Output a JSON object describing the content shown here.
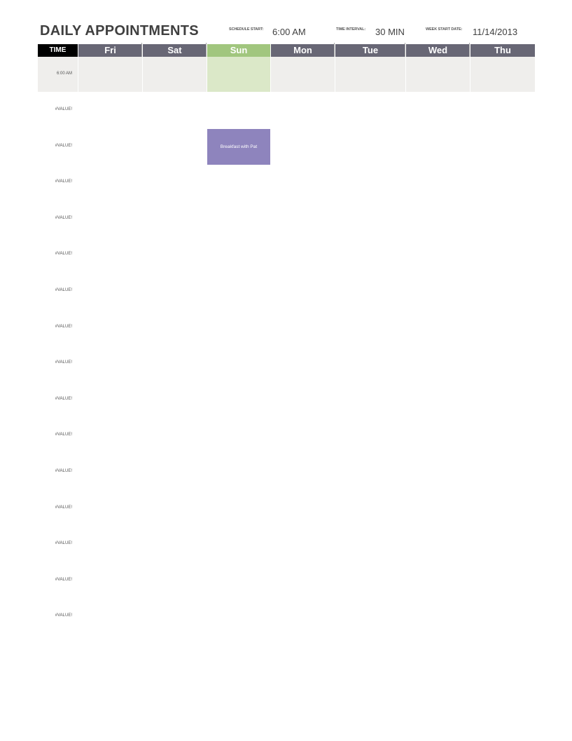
{
  "header": {
    "title": "DAILY APPOINTMENTS",
    "schedule_start_label": "SCHEDULE START:",
    "schedule_start_value": "6:00 AM",
    "time_interval_label": "TIME INTERVAL:",
    "time_interval_value": "30 MIN",
    "week_start_label": "WEEK START DATE:",
    "week_start_value": "11/14/2013"
  },
  "grid": {
    "time_header": "TIME",
    "days": [
      "Fri",
      "Sat",
      "Sun",
      "Mon",
      "Tue",
      "Wed",
      "Thu"
    ],
    "highlighted_day": "Sun",
    "first_time": "6:00 AM",
    "time_labels": [
      "#VALUE!",
      "#VALUE!",
      "#VALUE!",
      "#VALUE!",
      "#VALUE!",
      "#VALUE!",
      "#VALUE!",
      "#VALUE!",
      "#VALUE!",
      "#VALUE!",
      "#VALUE!",
      "#VALUE!",
      "#VALUE!",
      "#VALUE!",
      "#VALUE!"
    ]
  },
  "events": [
    {
      "day": "Sun",
      "slot": 2,
      "title": "Breakfast with Pat",
      "color": "#8e84bd"
    }
  ],
  "colors": {
    "header_bg": "#686775",
    "time_header_bg": "#000000",
    "today_header_bg": "#a1c67e",
    "today_cell_bg": "#dbe8c8",
    "row_bg": "#efeeec"
  }
}
